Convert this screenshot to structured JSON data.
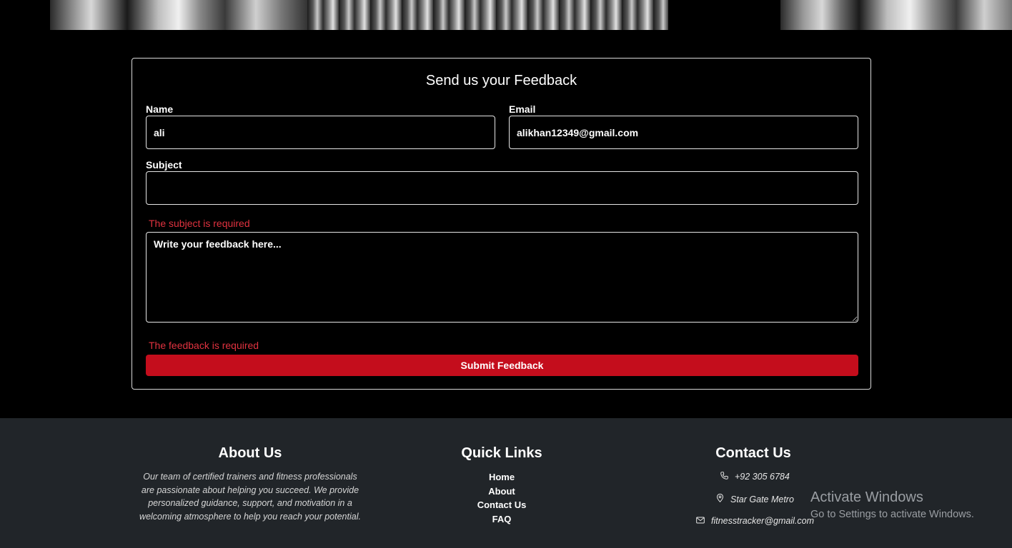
{
  "form": {
    "title": "Send us your Feedback",
    "name_label": "Name",
    "name_value": "ali",
    "email_label": "Email",
    "email_value": "alikhan12349@gmail.com",
    "subject_label": "Subject",
    "subject_value": "",
    "subject_error": "The subject is required",
    "feedback_placeholder": "Write your feedback here...",
    "feedback_error": "The feedback is required",
    "submit_label": "Submit Feedback",
    "accent_color": "#c40d1c",
    "error_color": "#e0323f"
  },
  "footer": {
    "about": {
      "heading": "About Us",
      "text": "Our team of certified trainers and fitness professionals are passionate about helping you succeed. We provide personalized guidance, support, and motivation in a welcoming atmosphere to help you reach your potential."
    },
    "quick_links": {
      "heading": "Quick Links",
      "items": [
        "Home",
        "About",
        "Contact Us",
        "FAQ"
      ]
    },
    "contact": {
      "heading": "Contact Us",
      "phone": "+92 305 6784",
      "address": "Star Gate Metro",
      "email": "fitnesstracker@gmail.com",
      "icons": [
        "phone-icon",
        "location-pin-icon",
        "envelope-icon"
      ]
    }
  },
  "watermark": {
    "line1": "Activate Windows",
    "line2": "Go to Settings to activate Windows."
  }
}
